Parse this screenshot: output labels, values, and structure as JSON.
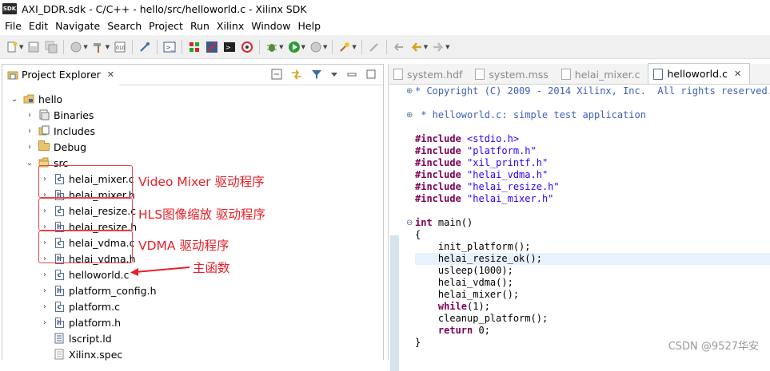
{
  "window": {
    "logo": "SDK",
    "title": "AXI_DDR.sdk - C/C++ - hello/src/helloworld.c - Xilinx SDK"
  },
  "menu": [
    {
      "label": "File",
      "key": "F"
    },
    {
      "label": "Edit",
      "key": "E"
    },
    {
      "label": "Navigate",
      "key": "N"
    },
    {
      "label": "Search",
      "key": "a"
    },
    {
      "label": "Project",
      "key": "P"
    },
    {
      "label": "Run",
      "key": "R"
    },
    {
      "label": "Xilinx",
      "key": "X"
    },
    {
      "label": "Window",
      "key": "W"
    },
    {
      "label": "Help",
      "key": "H"
    }
  ],
  "explorer": {
    "tab_label": "Project Explorer",
    "tree": [
      {
        "label": "hello",
        "icon": "project-folder-icon",
        "chevron": "expanded"
      },
      {
        "label": "Binaries",
        "icon": "binaries-icon",
        "chevron": "collapsed"
      },
      {
        "label": "Includes",
        "icon": "includes-icon",
        "chevron": "collapsed"
      },
      {
        "label": "Debug",
        "icon": "folder-icon",
        "chevron": "collapsed"
      },
      {
        "label": "src",
        "icon": "folder-icon",
        "chevron": "expanded"
      },
      {
        "label": "helai_mixer.c",
        "icon": "c-file-icon",
        "chevron": "collapsed"
      },
      {
        "label": "helai_mixer.h",
        "icon": "h-file-icon",
        "chevron": "collapsed"
      },
      {
        "label": "helai_resize.c",
        "icon": "c-file-icon",
        "chevron": "collapsed"
      },
      {
        "label": "helai_resize.h",
        "icon": "h-file-icon",
        "chevron": "collapsed"
      },
      {
        "label": "helai_vdma.c",
        "icon": "c-file-icon",
        "chevron": "collapsed"
      },
      {
        "label": "helai_vdma.h",
        "icon": "h-file-icon",
        "chevron": "collapsed"
      },
      {
        "label": "helloworld.c",
        "icon": "c-file-icon",
        "chevron": "collapsed"
      },
      {
        "label": "platform_config.h",
        "icon": "h-file-icon",
        "chevron": "collapsed"
      },
      {
        "label": "platform.c",
        "icon": "c-file-icon",
        "chevron": "collapsed"
      },
      {
        "label": "platform.h",
        "icon": "h-file-icon",
        "chevron": "collapsed"
      },
      {
        "label": "lscript.ld",
        "icon": "linker-script-icon",
        "chevron": "none"
      },
      {
        "label": "Xilinx.spec",
        "icon": "spec-file-icon",
        "chevron": "none"
      }
    ]
  },
  "annotations": {
    "mixer": "Video Mixer 驱动程序",
    "resize": "HLS图像缩放 驱动程序",
    "vdma": "VDMA 驱动程序",
    "main": "主函数",
    "color": "#e6202a"
  },
  "editor": {
    "tabs": [
      {
        "label": "system.hdf",
        "active": false
      },
      {
        "label": "system.mss",
        "active": false
      },
      {
        "label": "helai_mixer.c",
        "active": false
      },
      {
        "label": "helloworld.c",
        "active": true
      }
    ],
    "code": {
      "l1": "* Copyright (C) 2009 - 2014 Xilinx, Inc.  All rights reserved.",
      "l2": " * helloworld.c: simple test application",
      "inc_kw": "#include",
      "inc1": "<stdio.h>",
      "inc2": "\"platform.h\"",
      "inc3": "\"xil_printf.h\"",
      "inc4": "\"helai_vdma.h\"",
      "inc5": "\"helai_resize.h\"",
      "inc6": "\"helai_mixer.h\"",
      "int_kw": "int",
      "main_sig": " main()",
      "open_brace": "{",
      "b1": "    init_platform();",
      "b2": "    helai_resize_ok();",
      "b3": "    usleep(1000);",
      "b4": "    helai_vdma();",
      "b5": "    helai_mixer();",
      "while_kw": "while",
      "while_rest": "(1);",
      "b7": "    cleanup_platform();",
      "return_kw": "return",
      "return_rest": " 0;",
      "close_brace": "}"
    }
  },
  "watermark": "CSDN @9527华安"
}
